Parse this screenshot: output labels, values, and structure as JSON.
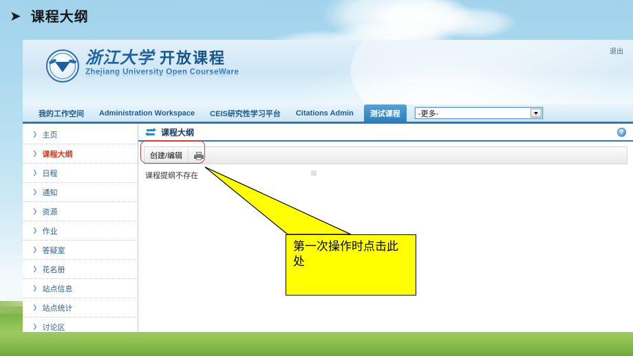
{
  "slide": {
    "bullet_glyph": "➤",
    "title": "课程大纲"
  },
  "site": {
    "logout_label": "退出",
    "brand": {
      "university_cn": "浙江大学",
      "ocw_cn": "开放课程",
      "english": "Zhejiang University Open CourseWare",
      "seal_icon": "zju-seal-icon"
    },
    "nav": {
      "items": [
        {
          "label": "我的工作空间",
          "active": false
        },
        {
          "label": "Administration Workspace",
          "active": false
        },
        {
          "label": "CEIS研究性学习平台",
          "active": false
        },
        {
          "label": "Citations Admin",
          "active": false
        },
        {
          "label": "测试课程",
          "active": true
        }
      ],
      "select_value": "-更多-",
      "select_icon": "chevron-down-icon"
    }
  },
  "sidebar": {
    "items": [
      {
        "label": "主页",
        "current": false
      },
      {
        "label": "课程大纲",
        "current": true
      },
      {
        "label": "日程",
        "current": false
      },
      {
        "label": "通知",
        "current": false
      },
      {
        "label": "资源",
        "current": false
      },
      {
        "label": "作业",
        "current": false
      },
      {
        "label": "答疑室",
        "current": false
      },
      {
        "label": "花名册",
        "current": false
      },
      {
        "label": "站点信息",
        "current": false
      },
      {
        "label": "站点统计",
        "current": false
      },
      {
        "label": "讨论区",
        "current": false
      }
    ]
  },
  "content": {
    "header_icon": "refresh-arrows-icon",
    "title": "课程大纲",
    "help_icon_label": "?",
    "toolbar": {
      "create_edit_label": "创建/编辑",
      "print_icon": "printer-icon"
    },
    "empty_message": "课程提纲不存在"
  },
  "annotation": {
    "callout_text": "第一次操作时点击此处",
    "callout_fill": "#ffff00",
    "highlight_color": "#e03b2f"
  },
  "colors": {
    "sky_top": "#a2d3ec",
    "grass": "#8cbf52",
    "nav_accent": "#2a7ab8",
    "active_tab": "#3d8fcc",
    "sidebar_link": "#2c5f8a",
    "sidebar_current": "#d63b1f"
  }
}
